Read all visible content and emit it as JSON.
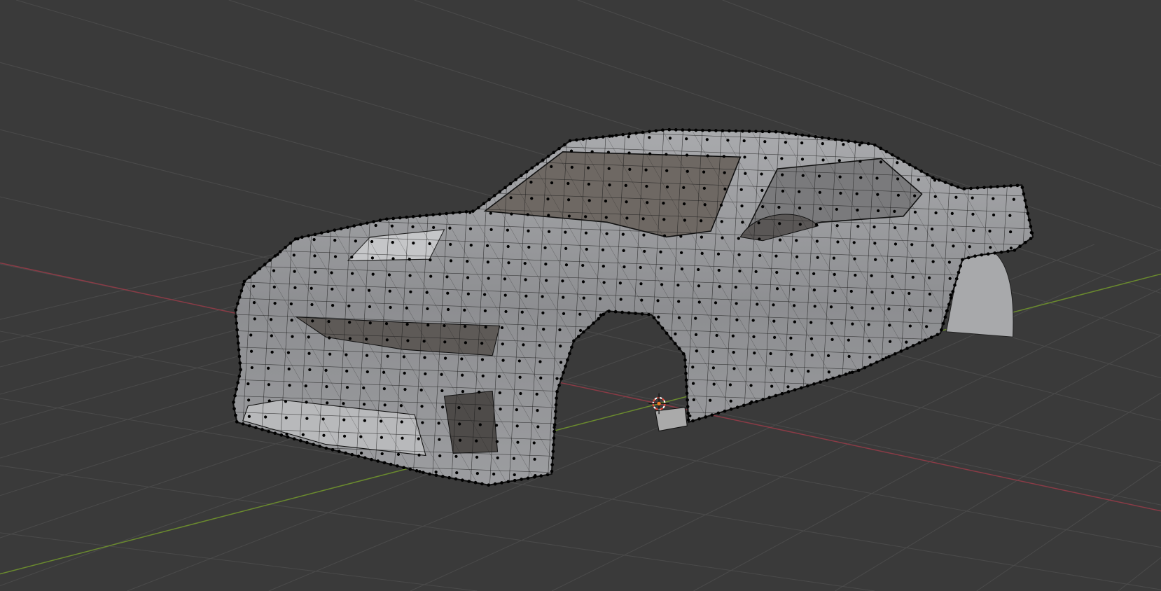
{
  "viewport": {
    "colors": {
      "background": "#3a3a3a",
      "grid": "#4a4a4a",
      "x_axis": "#8a3b46",
      "y_axis": "#6a8a2e",
      "mesh_face": "#8e8f92",
      "mesh_face_light": "#b4b5b8",
      "mesh_dark": "#5e5a57",
      "wire": "#1a1a1a",
      "vertex": "#000000",
      "cursor_red": "#e04a3a"
    }
  }
}
